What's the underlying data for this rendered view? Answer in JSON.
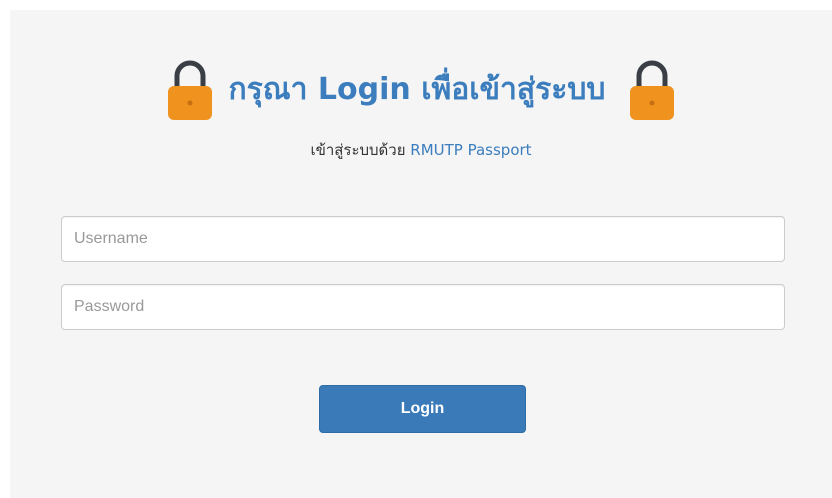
{
  "header": {
    "title": "กรุณา Login เพื่อเข้าสู่ระบบ",
    "icon_left": "lock-icon",
    "icon_right": "lock-icon",
    "icon_color": "#f0931e",
    "shackle_color": "#3a3f45"
  },
  "subtitle": {
    "text": "เข้าสู่ระบบด้วย",
    "link": "RMUTP Passport"
  },
  "form": {
    "username_placeholder": "Username",
    "username_value": "",
    "password_placeholder": "Password",
    "password_value": "",
    "login_label": "Login"
  },
  "colors": {
    "accent": "#3b7dbd",
    "button": "#3a7ab8",
    "background": "#f5f5f5"
  }
}
